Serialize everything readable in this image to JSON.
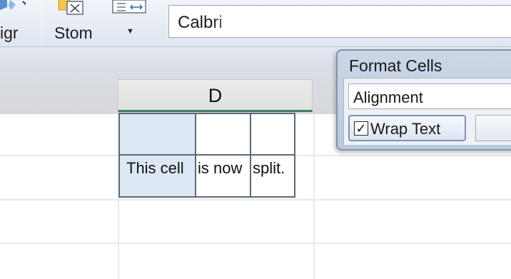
{
  "ribbon": {
    "partial_label": "igr",
    "custom_label": "Stom",
    "dropdown_arrow": "▼",
    "font_name": "Calbri"
  },
  "sheet": {
    "column_header": "D",
    "split_cells": {
      "left": "This cell",
      "middle": "is now",
      "right": "split."
    }
  },
  "dialog": {
    "title": "Format Cells",
    "section": "Alignment",
    "wrap_text_label": "Wrap Text",
    "wrap_text_checked": true,
    "check_glyph": "✓"
  },
  "icons": [
    "paste-icon",
    "format-icon",
    "merge-icon",
    "dropdown-arrow-icon",
    "checkbox-icon"
  ],
  "colors": {
    "accent_green": "#3f7e62",
    "selection_blue": "#dde8f5",
    "dialog_frame": "#b9c9dc"
  }
}
